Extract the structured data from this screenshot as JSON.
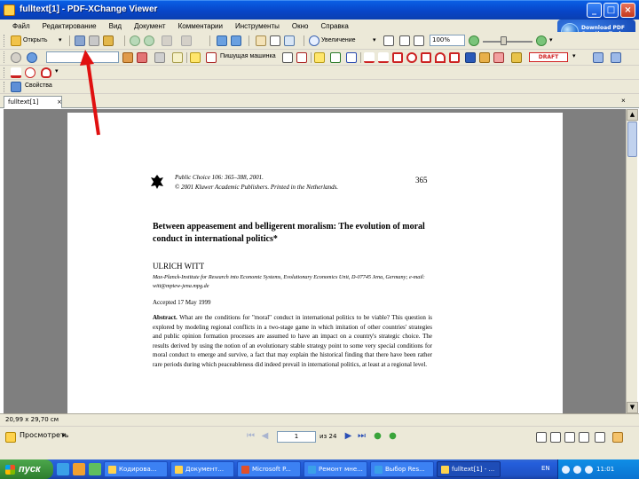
{
  "window": {
    "title": "fulltext[1] - PDF-XChange Viewer"
  },
  "menu": [
    "Файл",
    "Редактирование",
    "Вид",
    "Документ",
    "Комментарии",
    "Инструменты",
    "Окно",
    "Справка"
  ],
  "ad": {
    "text": "Download PDF\nCreation Tools"
  },
  "toolbar1": {
    "open_label": "Открыть",
    "zoom_label": "Увеличение",
    "zoom_value": "100%"
  },
  "toolbar2": {
    "typewriter_label": "Пишущая машинка",
    "stamp_label": "DRAFT"
  },
  "toolbar4": {
    "properties_label": "Свойства"
  },
  "tabs": {
    "document_tab": "fulltext[1]"
  },
  "document": {
    "journal_line_1": "Public Choice 106: 365–388, 2001.",
    "journal_line_2": "© 2001 Kluwer Academic Publishers. Printed in the Netherlands.",
    "page_number": "365",
    "title": "Between appeasement and belligerent moralism: The evolution of moral conduct in international politics*",
    "author": "ULRICH WITT",
    "affiliation": "Max-Planck-Institute for Research into Economic Systems, Evolutionary Economics Unit, D-07745 Jena, Germany; e-mail: witt@mpiew-jena.mpg.de",
    "accepted": "Accepted 17 May 1999",
    "abstract_head": "Abstract.",
    "abstract_body": "What are the conditions for \"moral\" conduct in international politics to be viable? This question is explored by modeling regional conflicts in a two-stage game in which imitation of other countries' strategies and public opinion formation processes are assumed to have an impact on a country's strategic choice. The results derived by using the notion of an evolutionary stable strategy point to some very special conditions for moral conduct to emerge and survive, a fact that may explain the historical finding that there have been rather rare periods during which peaceableness did indeed prevail in international politics, at least at a regional level."
  },
  "statusbar": {
    "dimensions": "20,99 x 29,70 см"
  },
  "navbar": {
    "view_option": "Просмотреть",
    "page_field": "1",
    "page_of": "из 24"
  },
  "taskbar": {
    "start_label": "пуск",
    "buttons": [
      "Кодирова...",
      "Документ...",
      "Microsoft P...",
      "Ремонт мне...",
      "Выбор Res...",
      "fulltext[1] - ..."
    ],
    "language": "EN",
    "clock": "11:01"
  },
  "colors": {
    "titlebar": "#0a5fe5",
    "chrome": "#ece9d8",
    "doc_background": "#7f7f7f",
    "arrow": "#e01010",
    "taskbar": "#245edb",
    "start_button": "#3a8f3a"
  }
}
